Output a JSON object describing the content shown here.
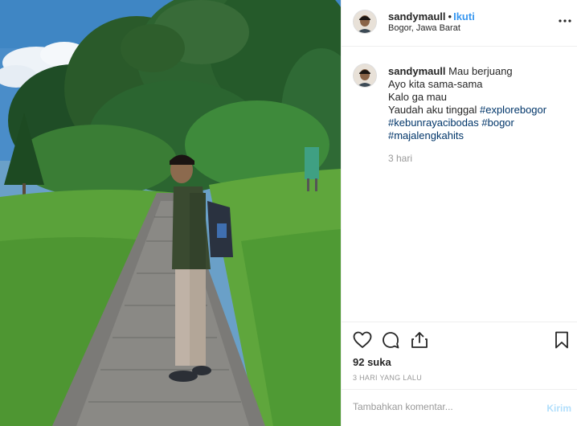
{
  "post": {
    "author": "sandymaull",
    "separator": "•",
    "follow_label": "Ikuti",
    "location": "Bogor, Jawa Barat",
    "more_icon": "more-horizontal-icon"
  },
  "caption": {
    "author": "sandymaull",
    "line1_text": "Mau berjuang",
    "line2": "Ayo kita sama-sama",
    "line3": "Kalo ga mau",
    "line4_text": "Yaudah aku tinggal",
    "hashtags": [
      "#explorebogor",
      "#kebunrayacibodas",
      "#bogor",
      "#majalengkahits"
    ],
    "time_ago": "3 hari"
  },
  "actions": {
    "like_icon": "heart-icon",
    "comment_icon": "comment-icon",
    "share_icon": "share-icon",
    "save_icon": "bookmark-icon"
  },
  "stats": {
    "likes": "92 suka",
    "posted": "3 HARI YANG LALU"
  },
  "comment_box": {
    "placeholder": "Tambahkan komentar...",
    "send_label": "Kirim"
  },
  "colors": {
    "accent": "#3897f0",
    "hashtag": "#003569",
    "muted": "#999999",
    "send_disabled": "#b2dffc"
  }
}
